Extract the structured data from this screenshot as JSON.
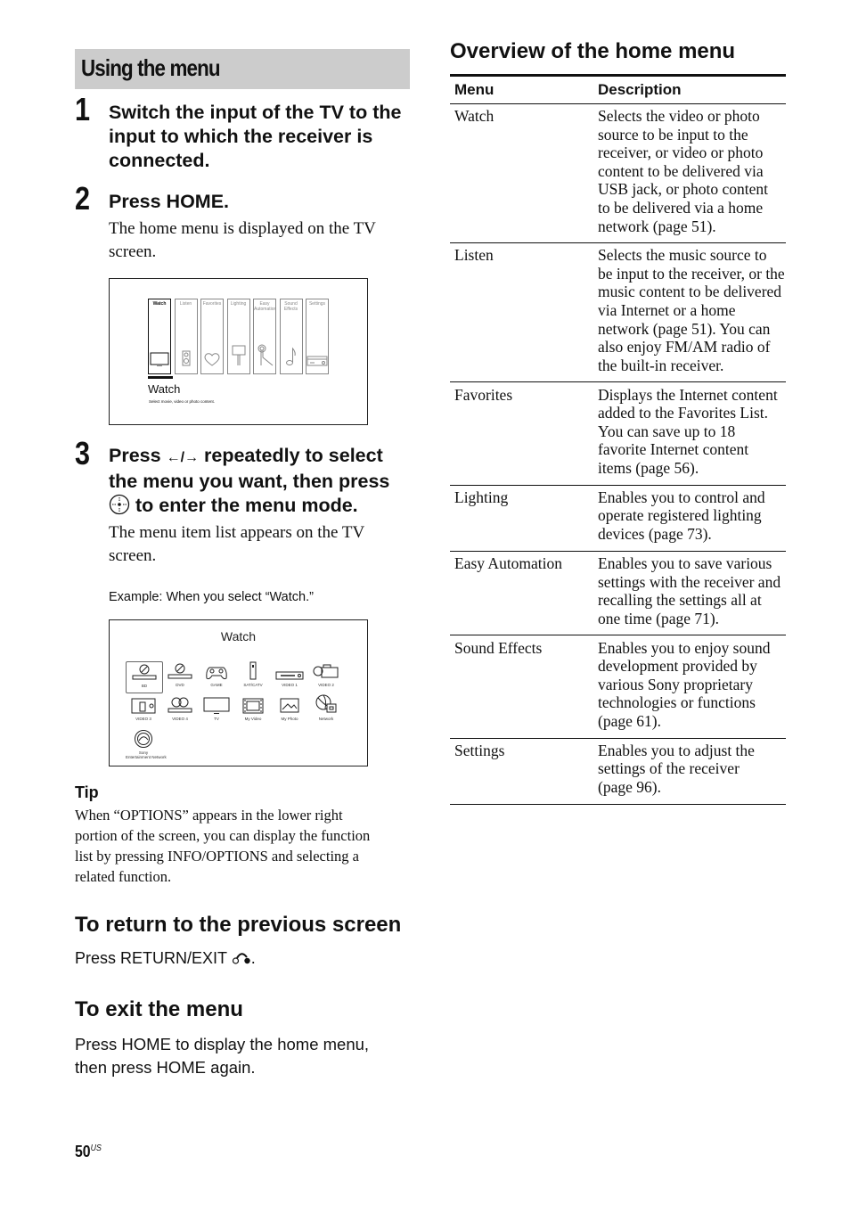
{
  "section": {
    "title": "Using the menu"
  },
  "steps": [
    {
      "number": "1",
      "title_lines": [
        "Switch the input of the TV to the",
        "input to which the receiver is",
        "connected."
      ]
    },
    {
      "number": "2",
      "title": "Press HOME.",
      "body_lines": [
        "The home menu is displayed on the TV",
        "screen."
      ]
    },
    {
      "number": "3",
      "title_line1_pre": "Press ",
      "title_line1_post": " repeatedly to select",
      "title_line2": "the menu you want, then press",
      "title_line3_post": " to enter the menu mode.",
      "body_lines": [
        "The menu item list appears on the TV",
        "screen."
      ],
      "example": "Example: When you select “Watch.”"
    }
  ],
  "home_menu_screen": {
    "items": [
      {
        "label": "Watch",
        "icon": "tv-icon",
        "active": true
      },
      {
        "label": "Listen",
        "icon": "speaker-icon"
      },
      {
        "label": "Favorites",
        "icon": "heart-icon"
      },
      {
        "label": "Lighting",
        "icon": "lamp-icon"
      },
      {
        "label": "Easy Automation",
        "label_lines": [
          "Easy",
          "Automation"
        ],
        "icon": "touch-icon"
      },
      {
        "label": "Sound Effects",
        "label_lines": [
          "Sound",
          "Effects"
        ],
        "icon": "music-note-icon"
      },
      {
        "label": "Settings",
        "icon": "receiver-icon"
      }
    ],
    "selected_title": "Watch",
    "selected_desc": "Select movie, video or photo content."
  },
  "watch_screen": {
    "title": "Watch",
    "items": [
      {
        "label": "BD",
        "icon": "bd-player-icon",
        "selected": true
      },
      {
        "label": "DVD",
        "icon": "dvd-player-icon"
      },
      {
        "label": "GAME",
        "icon": "gamepad-icon"
      },
      {
        "label": "SAT/CATV",
        "icon": "settop-box-icon"
      },
      {
        "label": "VIDEO 1",
        "icon": "vcr-icon"
      },
      {
        "label": "VIDEO 2",
        "icon": "camcorder-icon"
      },
      {
        "label": "VIDEO 3",
        "icon": "device-icon"
      },
      {
        "label": "VIDEO 4",
        "icon": "disc-player-icon"
      },
      {
        "label": "TV",
        "icon": "tv-icon"
      },
      {
        "label": "My Video",
        "icon": "film-icon"
      },
      {
        "label": "My Photo",
        "icon": "photo-icon"
      },
      {
        "label": "Network",
        "icon": "globe-icon"
      },
      {
        "label": "Sony Entertainment Network",
        "label_lines": [
          "Sony",
          "Entertainment Network"
        ],
        "icon": "sen-icon"
      }
    ]
  },
  "tip": {
    "heading": "Tip",
    "lines": [
      "When “OPTIONS” appears in the lower right",
      "portion of the screen, you can display the function",
      "list by pressing INFO/OPTIONS and selecting a",
      "related function."
    ]
  },
  "return_section": {
    "heading": "To return to the previous screen",
    "text": "Press RETURN/EXIT ",
    "suffix": "."
  },
  "exit_section": {
    "heading": "To exit the menu",
    "lines": [
      "Press HOME to display the home menu,",
      "then press HOME again."
    ]
  },
  "overview": {
    "heading": "Overview of the home menu",
    "columns": [
      "Menu",
      "Description"
    ],
    "rows": [
      {
        "menu": "Watch",
        "lines": [
          "Selects the video or photo",
          "source to be input to the",
          "receiver, or video or photo",
          "content to be delivered via",
          "USB jack, or photo content",
          "to be delivered via a home",
          "network (page 51)."
        ]
      },
      {
        "menu": "Listen",
        "lines": [
          "Selects the music source to",
          "be input to the receiver, or the",
          "music content to be delivered",
          "via Internet or a home",
          "network (page 51). You can",
          "also enjoy FM/AM radio of",
          "the built-in receiver."
        ]
      },
      {
        "menu": "Favorites",
        "lines": [
          "Displays the Internet content",
          "added to the Favorites List.",
          "You can save up to 18",
          "favorite Internet content",
          "items (page 56)."
        ]
      },
      {
        "menu": "Lighting",
        "lines": [
          "Enables you to control and",
          "operate registered lighting",
          "devices (page 73)."
        ]
      },
      {
        "menu": "Easy Automation",
        "lines": [
          "Enables you to save various",
          "settings with the receiver and",
          "recalling the settings all at",
          "one time (page 71)."
        ]
      },
      {
        "menu": "Sound Effects",
        "lines": [
          "Enables you to enjoy sound",
          "development provided by",
          "various Sony proprietary",
          "technologies or functions",
          "(page 61)."
        ]
      },
      {
        "menu": "Settings",
        "lines": [
          "Enables you to adjust the",
          "settings of the receiver",
          "(page 96)."
        ]
      }
    ]
  },
  "footer": {
    "page_number": "50",
    "region": "US"
  }
}
